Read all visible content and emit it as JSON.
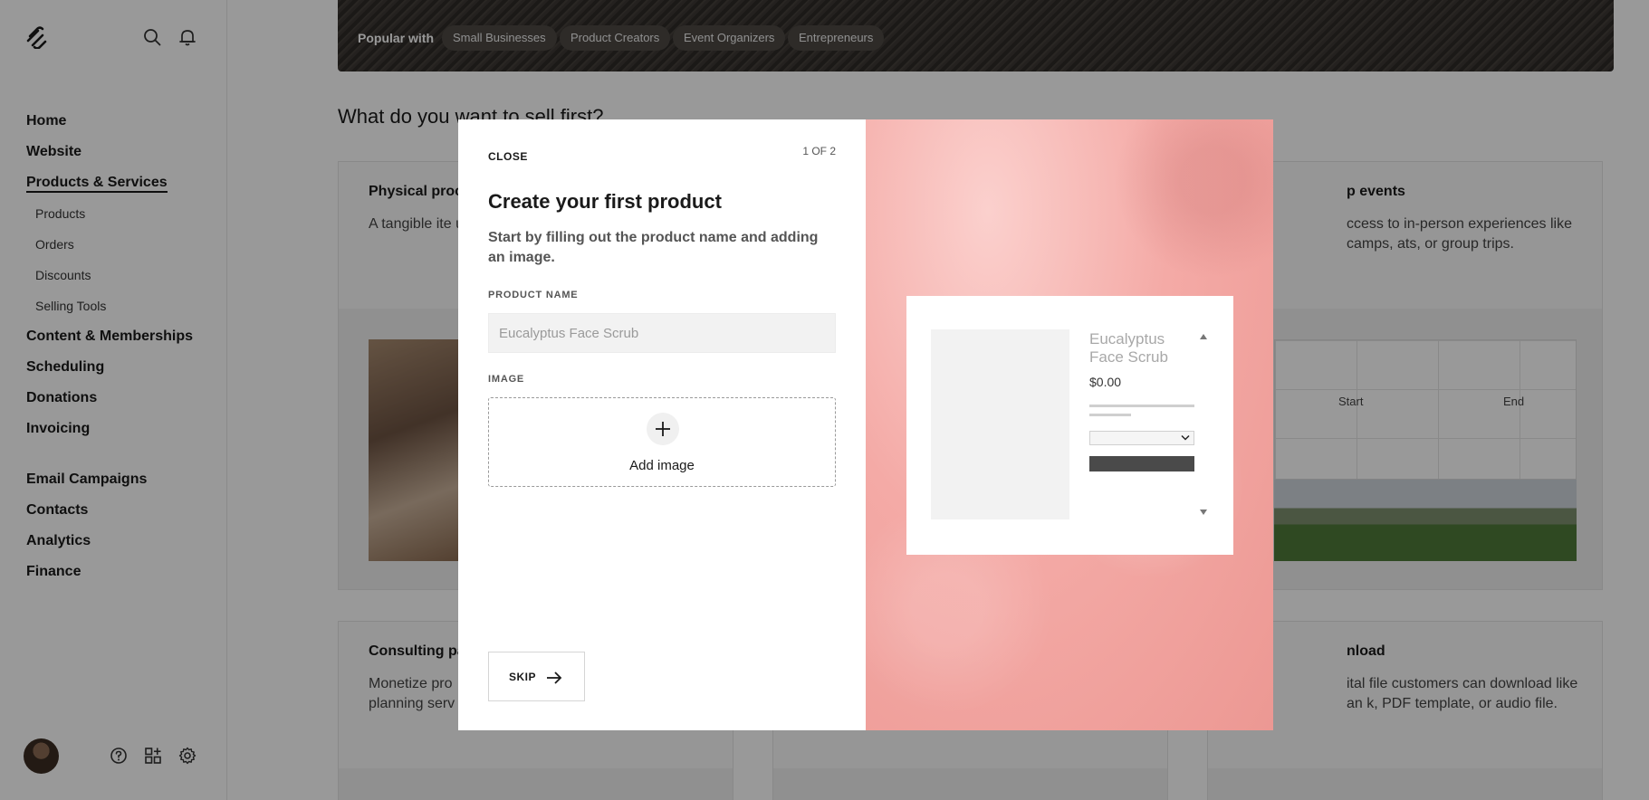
{
  "sidebar": {
    "nav": [
      {
        "label": "Home"
      },
      {
        "label": "Website"
      },
      {
        "label": "Products & Services",
        "active": true
      },
      {
        "label": "Products",
        "sub": true
      },
      {
        "label": "Orders",
        "sub": true
      },
      {
        "label": "Discounts",
        "sub": true
      },
      {
        "label": "Selling Tools",
        "sub": true
      },
      {
        "label": "Content & Memberships"
      },
      {
        "label": "Scheduling"
      },
      {
        "label": "Donations"
      },
      {
        "label": "Invoicing"
      },
      {
        "label": "Email Campaigns"
      },
      {
        "label": "Contacts"
      },
      {
        "label": "Analytics"
      },
      {
        "label": "Finance"
      }
    ],
    "icons": {
      "logo": "squarespace-logo-icon",
      "search": "search-icon",
      "notifications": "bell-icon",
      "help": "help-icon",
      "apps": "apps-grid-icon",
      "settings": "gear-icon"
    }
  },
  "main": {
    "banner": {
      "popular_label": "Popular with",
      "chips": [
        "Small Businesses",
        "Product Creators",
        "Event Organizers",
        "Entrepreneurs"
      ]
    },
    "sell_title": "What do you want to sell first?",
    "cards": [
      {
        "title": "Physical proc",
        "desc": "A tangible ite up."
      },
      {
        "title": "p events",
        "desc": "ccess to in-person experiences like camps, ats, or group trips."
      },
      {
        "title": "Consulting pa",
        "desc": "Monetize pro planning serv"
      },
      {
        "title": "nload",
        "desc": "ital file customers can download like an k, PDF template, or audio file."
      }
    ],
    "calendar": {
      "start_label": "Start",
      "end_label": "End"
    }
  },
  "modal": {
    "close_label": "CLOSE",
    "step": "1 OF 2",
    "title": "Create your first product",
    "subtitle": "Start by filling out the product name and adding an image.",
    "product_name_label": "PRODUCT NAME",
    "product_name_placeholder": "Eucalyptus Face Scrub",
    "product_name_value": "",
    "image_label": "IMAGE",
    "add_image_label": "Add image",
    "skip_label": "SKIP",
    "preview": {
      "name": "Eucalyptus Face Scrub",
      "price": "$0.00"
    }
  },
  "colors": {
    "overlay": "#00000066",
    "text": "#1a1a1a",
    "preview_bg": "#f4aaa6",
    "button_dark": "#4a4a4a"
  }
}
